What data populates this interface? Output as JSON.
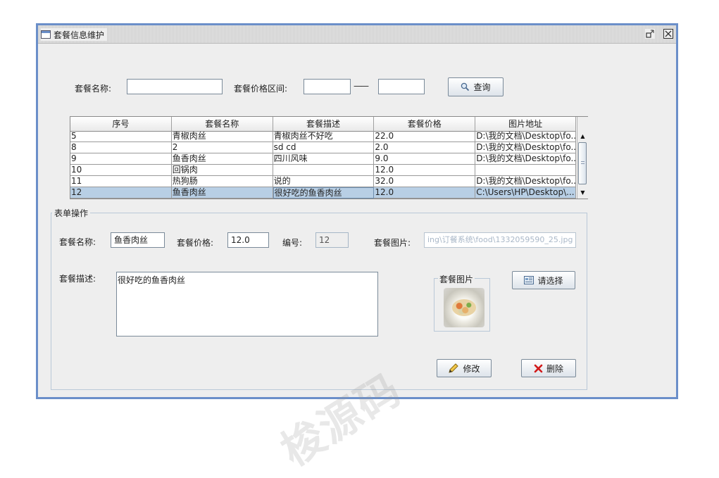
{
  "window": {
    "title": "套餐信息维护"
  },
  "search": {
    "name_label": "套餐名称:",
    "name_value": "",
    "price_label": "套餐价格区间:",
    "price_min": "",
    "price_sep": "——",
    "price_max": "",
    "query_button": "查询"
  },
  "table": {
    "columns": [
      "序号",
      "套餐名称",
      "套餐描述",
      "套餐价格",
      "图片地址"
    ],
    "rows": [
      [
        "5",
        "青椒肉丝",
        "青椒肉丝不好吃",
        "22.0",
        "D:\\我的文档\\Desktop\\fo..."
      ],
      [
        "8",
        "2",
        "sd cd",
        "2.0",
        "D:\\我的文档\\Desktop\\fo..."
      ],
      [
        "9",
        "鱼香肉丝",
        "四川风味",
        "9.0",
        "D:\\我的文档\\Desktop\\fo..."
      ],
      [
        "10",
        "回锅肉",
        "",
        "12.0",
        ""
      ],
      [
        "11",
        "热狗肠",
        "说的",
        "32.0",
        "D:\\我的文档\\Desktop\\fo..."
      ],
      [
        "12",
        "鱼香肉丝",
        "很好吃的鱼香肉丝",
        "12.0",
        "C:\\Users\\HP\\Desktop\\..."
      ]
    ],
    "selected_row": 5
  },
  "form": {
    "group_title": "表单操作",
    "name_label": "套餐名称:",
    "name_value": "鱼香肉丝",
    "price_label": "套餐价格:",
    "price_value": "12.0",
    "id_label": "编号:",
    "id_value": "12",
    "image_label": "套餐图片:",
    "image_path": "ing\\订餐系统\\food\\1332059590_25.jpg",
    "desc_label": "套餐描述:",
    "desc_value": "很好吃的鱼香肉丝",
    "image_box_title": "套餐图片",
    "choose_button": "请选择",
    "modify_button": "修改",
    "delete_button": "删除"
  },
  "watermark": {
    "text_1": "山梭源码",
    "text_2": "梭源码"
  },
  "colors": {
    "frame": "#6b8fc9",
    "selected_row": "#b8cfe5",
    "delete_icon": "#d11a1a"
  }
}
